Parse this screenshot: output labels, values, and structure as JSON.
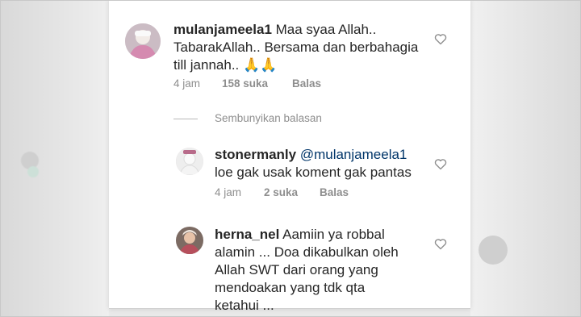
{
  "comments": [
    {
      "username": "mulanjameela1",
      "lines": [
        "Maa syaa Allah..",
        "TabarakAllah.. Bersama dan berbahagia",
        "till jannah.."
      ],
      "emoji": "🙏🙏",
      "time": "4 jam",
      "likes": "158 suka",
      "reply": "Balas"
    }
  ],
  "hide_replies_label": "Sembunyikan balasan",
  "replies": [
    {
      "username": "stonermanly",
      "mention": "@mulanjameela1",
      "lines": [
        "loe gak usak koment gak pantas"
      ],
      "time": "4 jam",
      "likes": "2 suka",
      "reply": "Balas"
    },
    {
      "username": "herna_nel",
      "lines": [
        "Aamiin ya robbal",
        "alamin ... Doa dikabulkan oleh",
        "Allah SWT dari orang yang",
        "mendoakan yang tdk qta",
        "ketahui ..."
      ]
    }
  ],
  "accent": {
    "mention": "#003569",
    "muted": "#8e8e8e",
    "text": "#262626"
  }
}
